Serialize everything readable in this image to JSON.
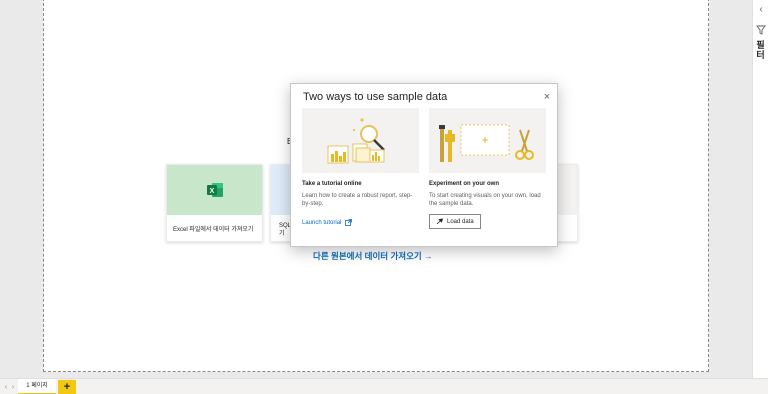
{
  "canvas": {
    "heading_partial": "Ę",
    "tiles": [
      {
        "label": "Excel 파일에서 데이터 가져오기",
        "icon": "excel-icon"
      },
      {
        "label": "SQL 기",
        "icon": "sql-icon"
      }
    ],
    "other_sources_link": "다른 원본에서 데이터 가져오기 →"
  },
  "dialog": {
    "title": "Two ways to use sample data",
    "close_icon": "close-icon",
    "options": [
      {
        "title": "Take a tutorial online",
        "description": "Learn how to create a robust report, step-by-step.",
        "action_label": "Launch tutorial",
        "action_icon": "external-link-icon"
      },
      {
        "title": "Experiment on your own",
        "description": "To start creating visuals on your own, load the sample data.",
        "action_label": "Load data",
        "action_icon": "load-data-icon"
      }
    ]
  },
  "right_pane": {
    "label": "필터",
    "collapse_icon": "chevron-left-icon",
    "filter_icon": "filter-icon"
  },
  "bottom_bar": {
    "page_tab": "1 페이지",
    "add_page": "+",
    "nav_prev": "‹",
    "nav_next": "›"
  },
  "colors": {
    "accent_yellow": "#f2c811",
    "link_blue": "#0f6cbd",
    "excel_green": "#c8e6c9",
    "excel_icon": "#1d6f42"
  }
}
